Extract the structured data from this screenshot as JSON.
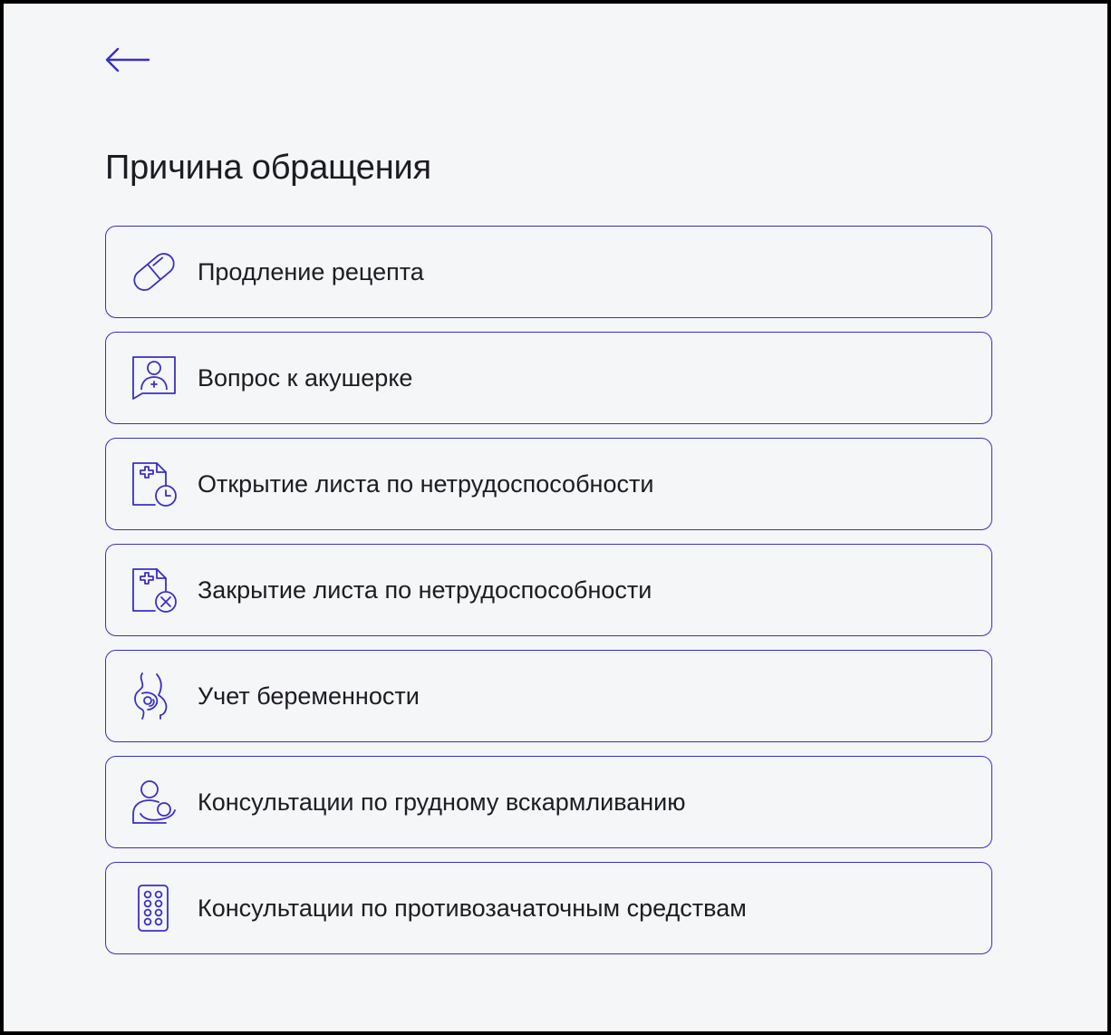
{
  "header": {
    "back_icon": "arrow-left-icon"
  },
  "page": {
    "title": "Причина обращения"
  },
  "colors": {
    "accent": "#3a2fc4",
    "background": "#f5f6f8",
    "text": "#1c1c22"
  },
  "options": [
    {
      "label": "Продление рецепта",
      "icon": "pill-capsule-icon"
    },
    {
      "label": "Вопрос к акушерке",
      "icon": "midwife-chat-icon"
    },
    {
      "label": "Открытие листа по нетрудоспособности",
      "icon": "sick-leave-open-icon"
    },
    {
      "label": "Закрытие листа по нетрудоспособности",
      "icon": "sick-leave-close-icon"
    },
    {
      "label": "Учет беременности",
      "icon": "pregnancy-icon"
    },
    {
      "label": "Консультации по грудному вскармливанию",
      "icon": "breastfeeding-icon"
    },
    {
      "label": "Консультации по противозачаточным средствам",
      "icon": "contraceptive-pills-icon"
    }
  ]
}
